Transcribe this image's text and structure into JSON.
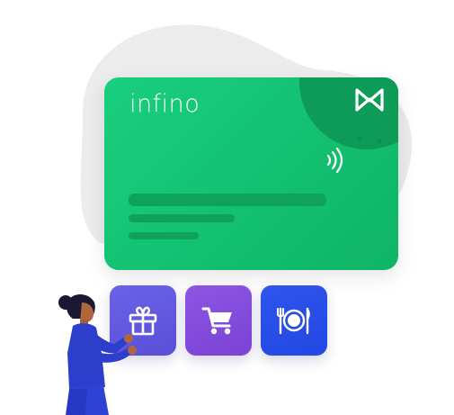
{
  "card": {
    "brand": "infino"
  },
  "reward_tiles": [
    {
      "icon": "gift-icon"
    },
    {
      "icon": "cart-icon"
    },
    {
      "icon": "dining-icon"
    }
  ],
  "colors": {
    "card_green": "#14c474",
    "card_corner": "#0e9a57",
    "tile_gift": "#6259e0",
    "tile_cart": "#8550dd",
    "tile_food": "#284eea",
    "blob": "#ececec"
  }
}
